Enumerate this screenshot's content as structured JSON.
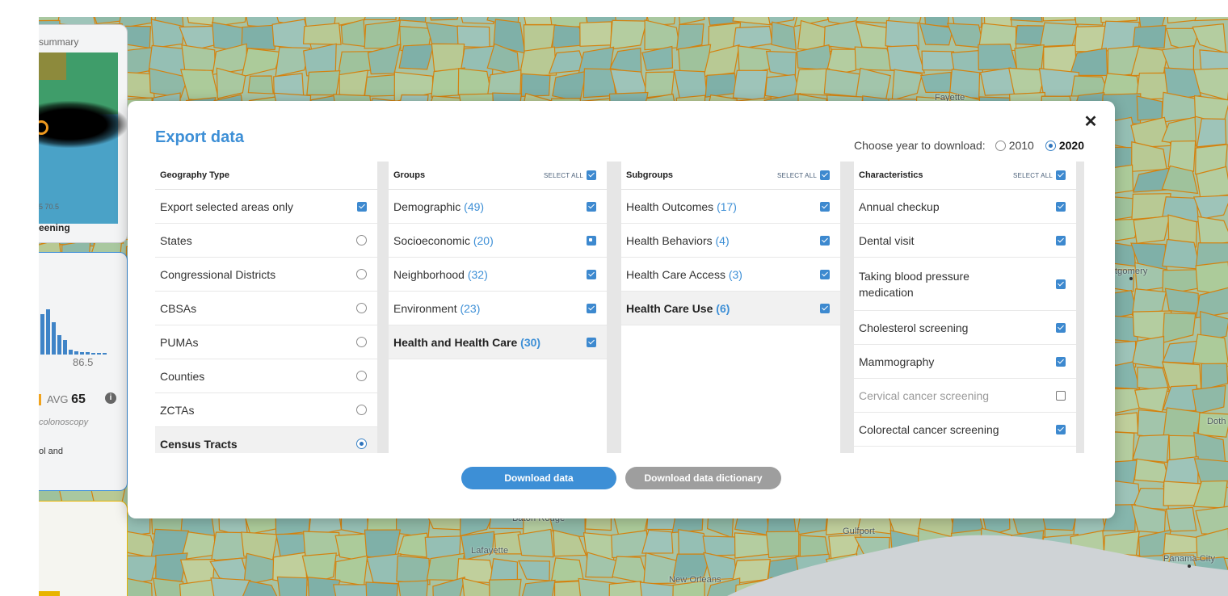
{
  "map_labels": {
    "fayette": "Fayette",
    "montgomery": "tgomery",
    "dothan": "Doth",
    "baton_rouge": "Baton Rouge",
    "lafayette": "Lafayette",
    "gulfport": "Gulfport",
    "new_orleans": "New Orleans",
    "panama_city": "Panama City"
  },
  "side_panel": {
    "summary_label": "summary",
    "tick_label": "5 70.5",
    "screening_label": "eening",
    "hist_max": "86.5",
    "avg_label": "AVG",
    "avg_value": "65",
    "metric_label": "colonoscopy",
    "footer_text": "ol and"
  },
  "dialog": {
    "title": "Export data",
    "close_label": "✕",
    "year_prompt": "Choose year to download:",
    "years": [
      {
        "label": "2010",
        "selected": false
      },
      {
        "label": "2020",
        "selected": true
      }
    ],
    "select_all_label": "SELECT ALL",
    "geography": {
      "header": "Geography Type",
      "items": [
        {
          "label": "Export selected areas only",
          "control": "checkbox",
          "state": "checked"
        },
        {
          "label": "States",
          "control": "radio",
          "state": "off"
        },
        {
          "label": "Congressional Districts",
          "control": "radio",
          "state": "off"
        },
        {
          "label": "CBSAs",
          "control": "radio",
          "state": "off"
        },
        {
          "label": "PUMAs",
          "control": "radio",
          "state": "off"
        },
        {
          "label": "Counties",
          "control": "radio",
          "state": "off"
        },
        {
          "label": "ZCTAs",
          "control": "radio",
          "state": "off"
        },
        {
          "label": "Census Tracts",
          "control": "radio",
          "state": "on"
        }
      ]
    },
    "groups": {
      "header": "Groups",
      "items": [
        {
          "label": "Demographic",
          "count": "(49)",
          "state": "checked"
        },
        {
          "label": "Socioeconomic",
          "count": "(20)",
          "state": "partial"
        },
        {
          "label": "Neighborhood",
          "count": "(32)",
          "state": "checked"
        },
        {
          "label": "Environment",
          "count": "(23)",
          "state": "checked"
        },
        {
          "label": "Health and Health Care",
          "count": "(30)",
          "state": "checked"
        }
      ]
    },
    "subgroups": {
      "header": "Subgroups",
      "items": [
        {
          "label": "Health Outcomes",
          "count": "(17)",
          "state": "checked"
        },
        {
          "label": "Health Behaviors",
          "count": "(4)",
          "state": "checked"
        },
        {
          "label": "Health Care Access",
          "count": "(3)",
          "state": "checked"
        },
        {
          "label": "Health Care Use",
          "count": "(6)",
          "state": "checked"
        }
      ]
    },
    "characteristics": {
      "header": "Characteristics",
      "items": [
        {
          "label": "Annual checkup",
          "state": "checked"
        },
        {
          "label": "Dental visit",
          "state": "checked"
        },
        {
          "label": "Taking blood pressure medication",
          "state": "checked"
        },
        {
          "label": "Cholesterol screening",
          "state": "checked"
        },
        {
          "label": "Mammography",
          "state": "checked"
        },
        {
          "label": "Cervical cancer screening",
          "state": "unchecked"
        },
        {
          "label": "Colorectal cancer screening",
          "state": "checked"
        }
      ]
    },
    "download_label": "Download data",
    "dictionary_label": "Download data dictionary"
  },
  "colors": {
    "accent": "#3d8fd6",
    "county_border": "#d4820f",
    "secondary_button": "#9e9e9e"
  }
}
